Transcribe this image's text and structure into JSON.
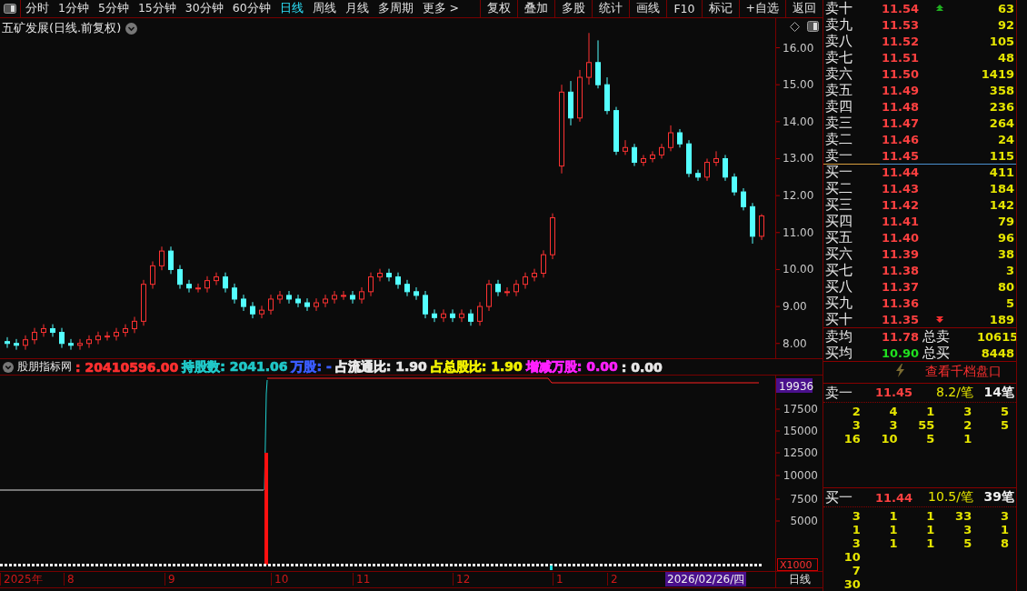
{
  "toolbar": {
    "periods": [
      {
        "label": "分时",
        "selected": false
      },
      {
        "label": "1分钟",
        "selected": false
      },
      {
        "label": "5分钟",
        "selected": false
      },
      {
        "label": "15分钟",
        "selected": false
      },
      {
        "label": "30分钟",
        "selected": false
      },
      {
        "label": "60分钟",
        "selected": false
      },
      {
        "label": "日线",
        "selected": true
      },
      {
        "label": "周线",
        "selected": false
      },
      {
        "label": "月线",
        "selected": false
      },
      {
        "label": "多周期",
        "selected": false
      },
      {
        "label": "更多 >",
        "selected": false
      }
    ],
    "buttons": [
      "复权",
      "叠加",
      "多股",
      "统计",
      "画线",
      "F10",
      "标记",
      "+自选",
      "返回"
    ]
  },
  "price_chart": {
    "title": "五矿发展(日线.前复权)",
    "chart_data": {
      "type": "candlestick",
      "ylim": [
        7.6,
        16.8
      ],
      "yticks": [
        {
          "value": 8,
          "label": "8.00"
        },
        {
          "value": 9,
          "label": "9.00"
        },
        {
          "value": 10,
          "label": "10.00"
        },
        {
          "value": 11,
          "label": "11.00"
        },
        {
          "value": 12,
          "label": "12.00"
        },
        {
          "value": 13,
          "label": "13.00"
        },
        {
          "value": 14,
          "label": "14.00"
        },
        {
          "value": 15,
          "label": "15.00"
        },
        {
          "value": 16,
          "label": "16.00"
        }
      ],
      "ohlc": [
        [
          8.05,
          8.17,
          7.88,
          8.0
        ],
        [
          8.0,
          8.12,
          7.83,
          7.95
        ],
        [
          7.95,
          8.22,
          7.83,
          8.1
        ],
        [
          8.1,
          8.42,
          7.98,
          8.3
        ],
        [
          8.3,
          8.52,
          8.18,
          8.4
        ],
        [
          8.4,
          8.52,
          8.18,
          8.3
        ],
        [
          8.3,
          8.42,
          7.88,
          8.0
        ],
        [
          8.0,
          8.12,
          7.83,
          7.95
        ],
        [
          7.95,
          8.12,
          7.83,
          8.0
        ],
        [
          8.0,
          8.22,
          7.88,
          8.1
        ],
        [
          8.1,
          8.32,
          7.98,
          8.2
        ],
        [
          8.2,
          8.32,
          8.08,
          8.2
        ],
        [
          8.2,
          8.42,
          8.08,
          8.3
        ],
        [
          8.3,
          8.52,
          8.18,
          8.4
        ],
        [
          8.4,
          8.72,
          8.28,
          8.6
        ],
        [
          8.6,
          9.72,
          8.48,
          9.6
        ],
        [
          9.6,
          10.22,
          9.48,
          10.1
        ],
        [
          10.1,
          10.62,
          9.98,
          10.5
        ],
        [
          10.5,
          10.62,
          9.88,
          10.0
        ],
        [
          10.0,
          10.12,
          9.48,
          9.6
        ],
        [
          9.6,
          9.72,
          9.38,
          9.5
        ],
        [
          9.5,
          9.62,
          9.38,
          9.5
        ],
        [
          9.5,
          9.82,
          9.38,
          9.7
        ],
        [
          9.7,
          9.92,
          9.58,
          9.8
        ],
        [
          9.8,
          9.92,
          9.38,
          9.5
        ],
        [
          9.5,
          9.62,
          9.08,
          9.2
        ],
        [
          9.2,
          9.32,
          8.88,
          9.0
        ],
        [
          9.0,
          9.12,
          8.68,
          8.8
        ],
        [
          8.8,
          9.02,
          8.68,
          8.9
        ],
        [
          8.9,
          9.32,
          8.78,
          9.2
        ],
        [
          9.2,
          9.42,
          9.08,
          9.3
        ],
        [
          9.3,
          9.42,
          9.08,
          9.2
        ],
        [
          9.2,
          9.32,
          8.98,
          9.1
        ],
        [
          9.1,
          9.22,
          8.88,
          9.0
        ],
        [
          9.0,
          9.22,
          8.88,
          9.1
        ],
        [
          9.1,
          9.32,
          8.98,
          9.2
        ],
        [
          9.2,
          9.42,
          9.08,
          9.3
        ],
        [
          9.3,
          9.42,
          9.18,
          9.3
        ],
        [
          9.3,
          9.42,
          9.08,
          9.2
        ],
        [
          9.2,
          9.52,
          9.08,
          9.4
        ],
        [
          9.4,
          9.92,
          9.28,
          9.8
        ],
        [
          9.8,
          10.02,
          9.68,
          9.9
        ],
        [
          9.9,
          10.02,
          9.68,
          9.8
        ],
        [
          9.8,
          9.92,
          9.48,
          9.6
        ],
        [
          9.6,
          9.72,
          9.28,
          9.4
        ],
        [
          9.4,
          9.52,
          9.18,
          9.3
        ],
        [
          9.3,
          9.42,
          8.68,
          8.8
        ],
        [
          8.8,
          8.92,
          8.58,
          8.7
        ],
        [
          8.7,
          8.92,
          8.58,
          8.8
        ],
        [
          8.8,
          8.92,
          8.58,
          8.7
        ],
        [
          8.7,
          8.92,
          8.58,
          8.8
        ],
        [
          8.8,
          8.92,
          8.48,
          8.6
        ],
        [
          8.6,
          9.12,
          8.48,
          9.0
        ],
        [
          9.0,
          9.72,
          8.88,
          9.6
        ],
        [
          9.6,
          9.72,
          9.28,
          9.4
        ],
        [
          9.4,
          9.52,
          9.28,
          9.4
        ],
        [
          9.4,
          9.72,
          9.28,
          9.6
        ],
        [
          9.6,
          9.92,
          9.48,
          9.8
        ],
        [
          9.8,
          10.02,
          9.68,
          9.9
        ],
        [
          9.9,
          10.52,
          9.78,
          10.4
        ],
        [
          10.4,
          11.52,
          10.28,
          11.4
        ],
        [
          12.8,
          15.0,
          12.6,
          14.8
        ],
        [
          14.8,
          15.1,
          13.9,
          14.1
        ],
        [
          14.1,
          15.4,
          14.0,
          15.2
        ],
        [
          15.2,
          16.4,
          15.0,
          15.6
        ],
        [
          15.6,
          16.2,
          14.9,
          15.0
        ],
        [
          15.0,
          15.2,
          14.2,
          14.3
        ],
        [
          14.3,
          14.4,
          13.1,
          13.2
        ],
        [
          13.2,
          13.5,
          13.1,
          13.3
        ],
        [
          13.3,
          13.4,
          12.8,
          12.9
        ],
        [
          12.9,
          13.1,
          12.8,
          13.0
        ],
        [
          13.0,
          13.2,
          12.9,
          13.1
        ],
        [
          13.1,
          13.4,
          13.0,
          13.3
        ],
        [
          13.3,
          13.9,
          13.2,
          13.7
        ],
        [
          13.7,
          13.8,
          13.3,
          13.4
        ],
        [
          13.4,
          13.5,
          12.5,
          12.6
        ],
        [
          12.6,
          12.7,
          12.4,
          12.5
        ],
        [
          12.5,
          13.0,
          12.4,
          12.9
        ],
        [
          12.9,
          13.2,
          12.8,
          13.0
        ],
        [
          13.0,
          13.1,
          12.4,
          12.5
        ],
        [
          12.5,
          12.6,
          12.0,
          12.1
        ],
        [
          12.1,
          12.2,
          11.6,
          11.7
        ],
        [
          11.7,
          11.8,
          10.7,
          10.9
        ],
        [
          10.9,
          11.5,
          10.8,
          11.45
        ]
      ]
    }
  },
  "indicator": {
    "name": "股朋指标网",
    "readings": [
      {
        "text": ": 20410596.00",
        "color": "#ff3030"
      },
      {
        "text": "持股数: 2041.06",
        "color": "#20c8c8"
      },
      {
        "text": "万股: -",
        "color": "#3a5cff"
      },
      {
        "text": "占流通比: 1.90",
        "color": "#e8e8e8"
      },
      {
        "text": "占总股比: 1.90",
        "color": "#f0f000"
      },
      {
        "text": "增减万股: 0.00",
        "color": "#ff20ff"
      },
      {
        "text": ": 0.00",
        "color": "#e8e8e8"
      }
    ],
    "current_value": "19936",
    "ticks": [
      "17500",
      "15000",
      "12500",
      "10000",
      "7500",
      "5000"
    ],
    "unit": "X1000"
  },
  "date_axis": {
    "labels": [
      "2025年",
      "8",
      "9",
      "10",
      "11",
      "12",
      "1",
      "2"
    ],
    "cursor_date": "2026/02/26/四",
    "period": "日线"
  },
  "order_book": {
    "asks": [
      {
        "name": "卖十",
        "price": "11.54",
        "volume": "63",
        "arrow": true
      },
      {
        "name": "卖九",
        "price": "11.53",
        "volume": "92",
        "arrow": false
      },
      {
        "name": "卖八",
        "price": "11.52",
        "volume": "105",
        "arrow": false
      },
      {
        "name": "卖七",
        "price": "11.51",
        "volume": "48",
        "arrow": false
      },
      {
        "name": "卖六",
        "price": "11.50",
        "volume": "1419",
        "arrow": false
      },
      {
        "name": "卖五",
        "price": "11.49",
        "volume": "358",
        "arrow": false
      },
      {
        "name": "卖四",
        "price": "11.48",
        "volume": "236",
        "arrow": false
      },
      {
        "name": "卖三",
        "price": "11.47",
        "volume": "264",
        "arrow": false
      },
      {
        "name": "卖二",
        "price": "11.46",
        "volume": "24",
        "arrow": false
      },
      {
        "name": "卖一",
        "price": "11.45",
        "volume": "115",
        "arrow": false
      }
    ],
    "bids": [
      {
        "name": "买一",
        "price": "11.44",
        "volume": "411",
        "arrow": false
      },
      {
        "name": "买二",
        "price": "11.43",
        "volume": "184",
        "arrow": false
      },
      {
        "name": "买三",
        "price": "11.42",
        "volume": "142",
        "arrow": false
      },
      {
        "name": "买四",
        "price": "11.41",
        "volume": "79",
        "arrow": false
      },
      {
        "name": "买五",
        "price": "11.40",
        "volume": "96",
        "arrow": false
      },
      {
        "name": "买六",
        "price": "11.39",
        "volume": "38",
        "arrow": false
      },
      {
        "name": "买七",
        "price": "11.38",
        "volume": "3",
        "arrow": false
      },
      {
        "name": "买八",
        "price": "11.37",
        "volume": "80",
        "arrow": false
      },
      {
        "name": "买九",
        "price": "11.36",
        "volume": "5",
        "arrow": false
      },
      {
        "name": "买十",
        "price": "11.35",
        "volume": "189",
        "arrow": true
      }
    ],
    "averages": [
      {
        "label": "卖均",
        "price": "11.78",
        "falling": false,
        "total_label": "总卖",
        "total": "10615"
      },
      {
        "label": "买均",
        "price": "10.90",
        "falling": true,
        "total_label": "总买",
        "total": "8448"
      }
    ],
    "depth_link": "查看千档盘口",
    "details": [
      {
        "label": "卖一",
        "price": "11.45",
        "per_trade": "8.2/笔",
        "count": "14笔",
        "rows": [
          [
            "2",
            "4",
            "1",
            "3",
            "5"
          ],
          [
            "3",
            "3",
            "55",
            "2",
            "5"
          ],
          [
            "16",
            "10",
            "5",
            "1",
            ""
          ]
        ]
      },
      {
        "label": "买一",
        "price": "11.44",
        "per_trade": "10.5/笔",
        "count": "39笔",
        "rows": [
          [
            "3",
            "1",
            "1",
            "33",
            "3"
          ],
          [
            "1",
            "1",
            "1",
            "3",
            "1"
          ],
          [
            "3",
            "1",
            "1",
            "5",
            "8"
          ],
          [
            "10",
            "",
            "",
            "",
            ""
          ],
          [
            "7",
            "",
            "",
            "",
            ""
          ],
          [
            "30",
            "",
            "",
            "",
            ""
          ]
        ]
      }
    ]
  }
}
